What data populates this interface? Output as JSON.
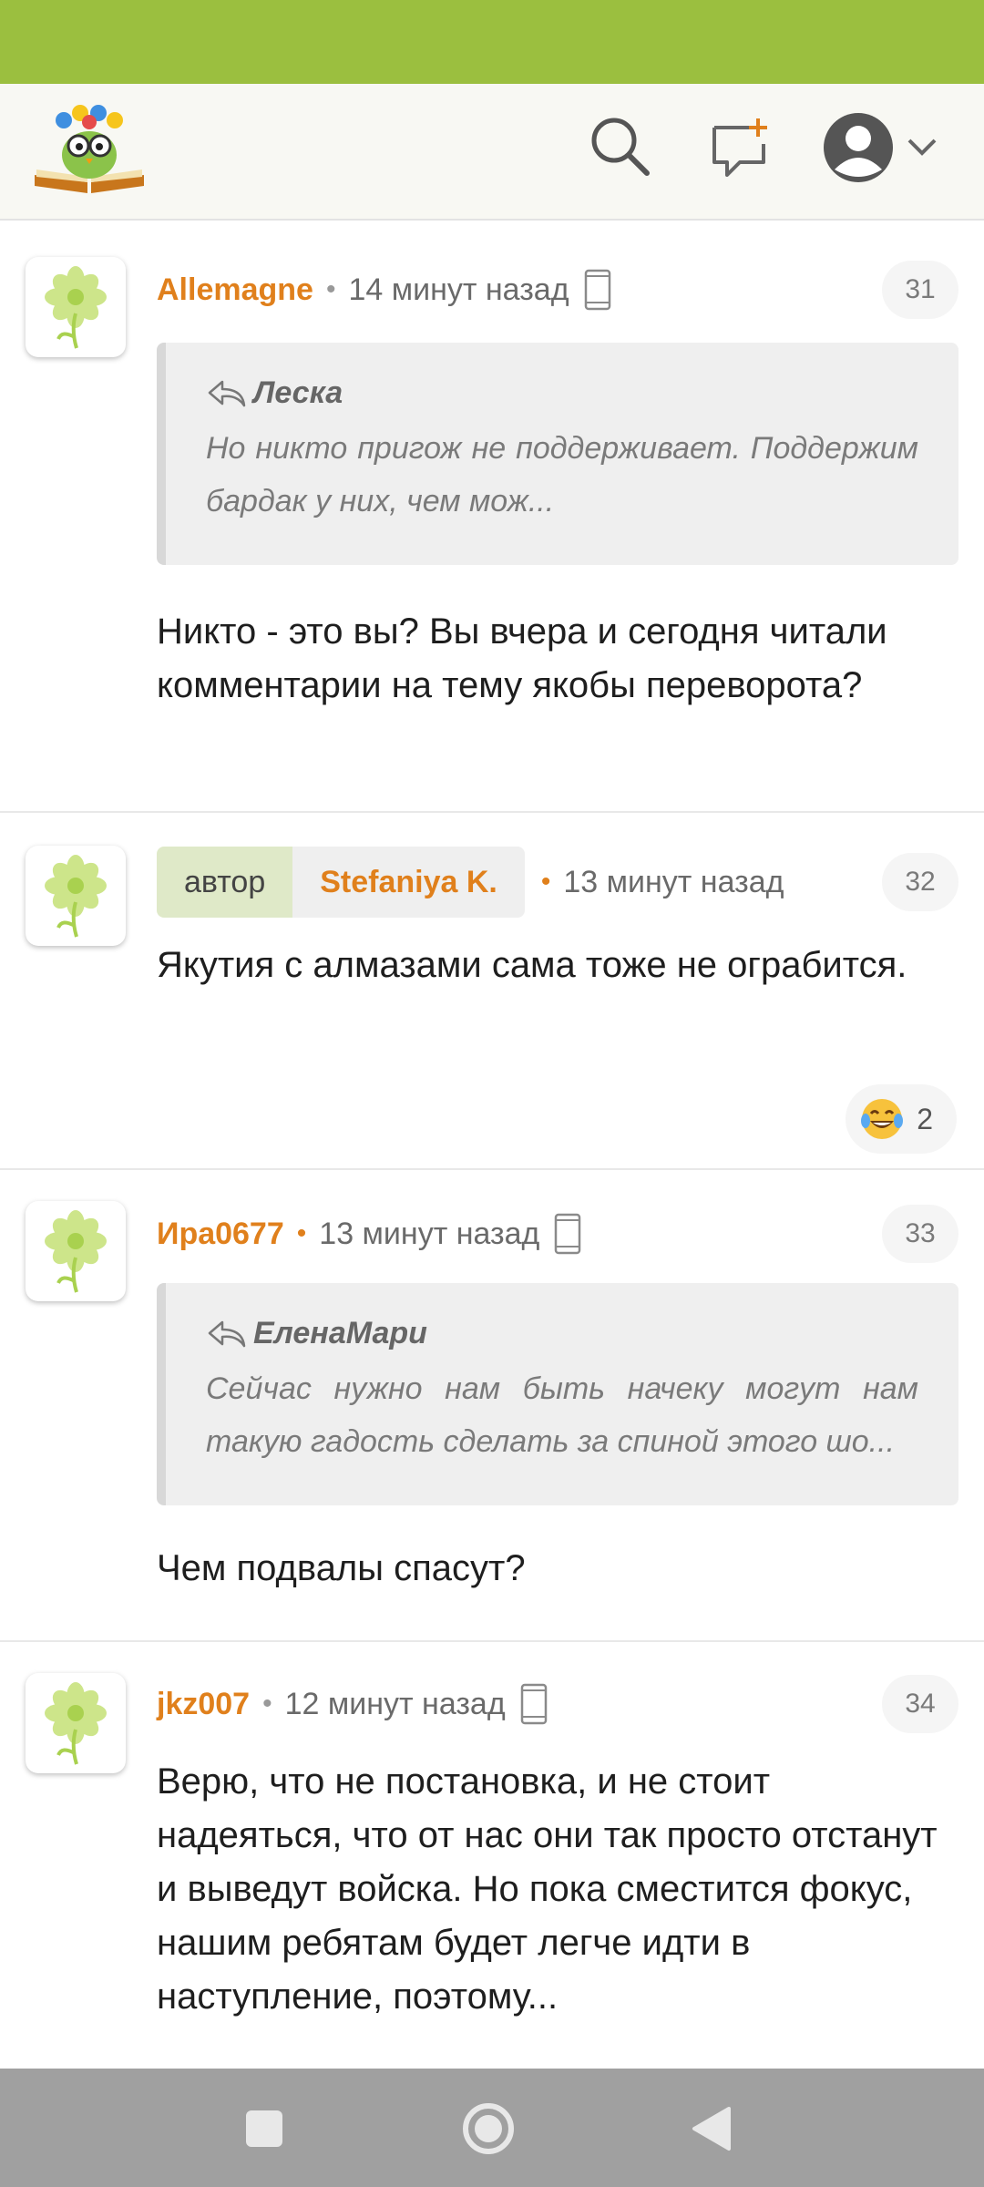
{
  "header": {
    "logo_name": "site-logo-owl-with-flowers",
    "icons": [
      "search-icon",
      "new-message-icon",
      "profile-icon",
      "chevron-down-icon"
    ]
  },
  "comments": [
    {
      "nick": "Allemagne",
      "time": "14 минут назад",
      "number": "31",
      "quote_author": "Леска",
      "quote_text": "Но никто пригож не поддерживает. Поддержим бардак у них, чем мож...",
      "text": "Никто - это вы? Вы вчера и сегодня читали комментарии на тему якобы переворота?"
    },
    {
      "badge_role": "автор",
      "nick": "Stefaniya K.",
      "time": "13 минут назад",
      "number": "32",
      "text": "Якутия с алмазами сама тоже не ограбится.",
      "reaction_count": "2",
      "reaction_icon": "laughing-tears-emoji"
    },
    {
      "nick": "Ира0677",
      "time": "13 минут назад",
      "number": "33",
      "quote_author": "ЕленаМари",
      "quote_text": "Сейчас нужно нам быть начеку могут нам такую гадость сделать за спиной этого шо...",
      "text": "Чем подвалы спасут?"
    },
    {
      "nick": "jkz007",
      "time": "12 минут назад",
      "number": "34",
      "text": "Верю, что не постановка, и не стоит надеяться, что от нас они так просто отстанут и выведут войска. Но пока сместится фокус, нашим ребятам будет легче идти в наступление, поэтому..."
    }
  ],
  "navbar": {
    "icons": [
      "recents-square-icon",
      "home-circle-icon",
      "back-triangle-icon"
    ]
  },
  "colors": {
    "status_bar": "#9bbf3f",
    "nick": "#e0801c",
    "author_badge": "#dfe9c8"
  }
}
